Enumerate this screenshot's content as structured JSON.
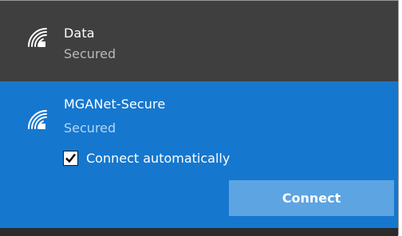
{
  "networks": [
    {
      "name": "Data",
      "status": "Secured",
      "icon": "wifi-secured-icon"
    },
    {
      "name": "MGANet-Secure",
      "status": "Secured",
      "icon": "wifi-secured-icon",
      "selected": true,
      "connect_automatically": {
        "label": "Connect automatically",
        "checked": true
      },
      "connect_button_label": "Connect"
    }
  ],
  "colors": {
    "selected_background": "#1677cf",
    "row_background": "#3f3f3f",
    "button_background": "#5da4e2"
  }
}
